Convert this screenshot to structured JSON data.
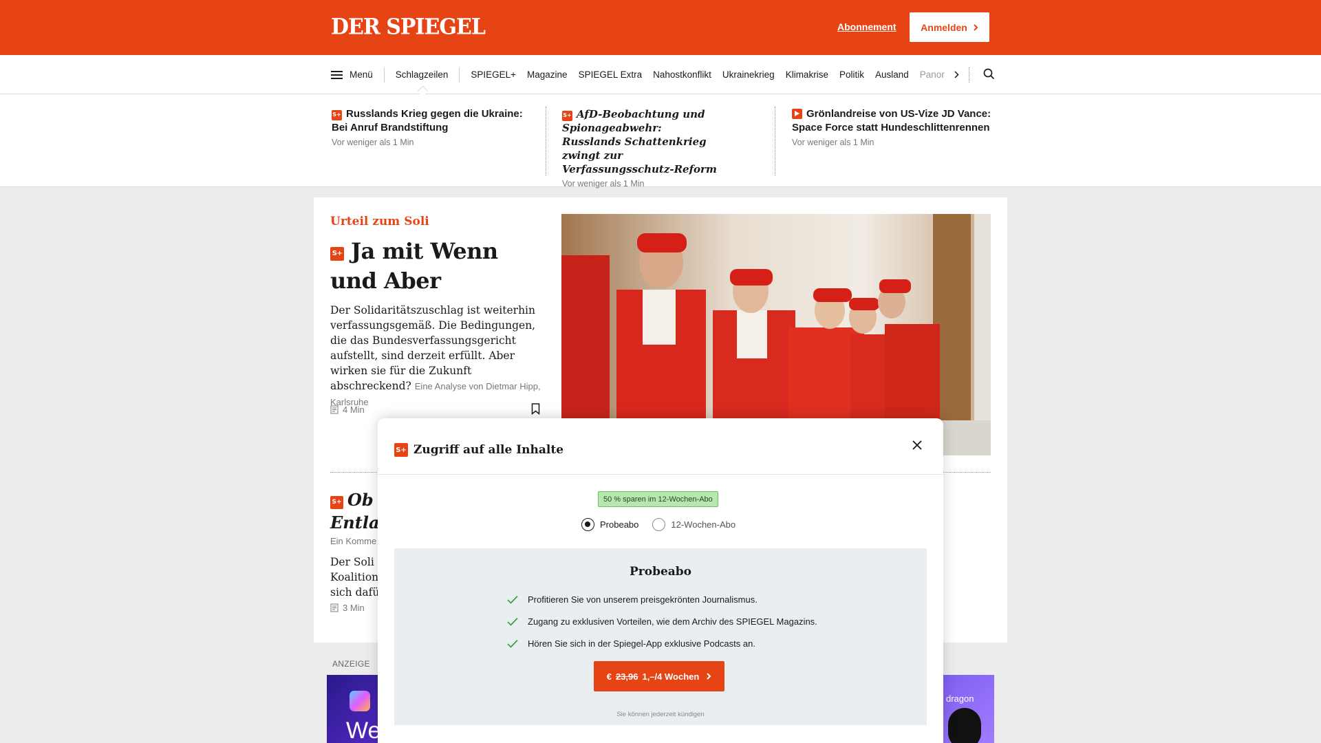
{
  "header": {
    "logo": "DER SPIEGEL",
    "abo_link": "Abonnement",
    "login_label": "Anmelden",
    "brand_color": "#e64415"
  },
  "nav": {
    "menu_label": "Menü",
    "active": "Schlagzeilen",
    "items": [
      "SPIEGEL+",
      "Magazine",
      "SPIEGEL Extra",
      "Nahostkonflikt",
      "Ukrainekrieg",
      "Klimakrise",
      "Politik",
      "Ausland"
    ],
    "truncated": "Panor",
    "icons": [
      "hamburger-icon",
      "chevron-right-icon",
      "search-icon"
    ]
  },
  "ticker": [
    {
      "badge": "S+",
      "title": "Russlands Krieg gegen die Ukraine: Bei Anruf Brandstiftung",
      "meta": "Vor weniger als 1 Min"
    },
    {
      "badge": "S+",
      "title": "AfD-Beobachtung und Spionageabwehr: Russlands Schattenkrieg zwingt zur Verfassungsschutz-Reform",
      "meta": "Vor weniger als 1 Min"
    },
    {
      "badge": "play",
      "title": "Grönlandreise von US-Vize JD Vance: Space Force statt Hundeschlittenrennen",
      "meta": "Vor weniger als 1 Min"
    }
  ],
  "lead": {
    "kicker": "Urteil zum Soli",
    "badge": "S+",
    "headline": "Ja mit Wenn und Aber",
    "teaser": "Der Solidaritätszuschlag ist weiterhin verfassungsgemäß. Die Bedingungen, die das Bundesverfassungsgericht aufstellt, sind derzeit erfüllt. Aber wirken sie für die Zukunft abschreckend?",
    "author": "Eine Analyse von Dietmar Hipp, Karlsruhe",
    "readtime": "4 Min"
  },
  "second": {
    "badge": "S+",
    "title_line1": "Ob",
    "title_line2": "Entlas",
    "meta": "Ein Komme",
    "teaser_lines": [
      "Der Soli is",
      "Koalition",
      "sich dafür"
    ],
    "readtime": "3 Min"
  },
  "ad": {
    "label": "ANZEIGE",
    "left_text": "We",
    "right_text": "dragon"
  },
  "modal": {
    "badge": "S+",
    "title": "Zugriff auf alle Inhalte",
    "save_badge": "50 % sparen im 12-Wochen-Abo",
    "options": [
      "Probeabo",
      "12-Wochen-Abo"
    ],
    "selected": "Probeabo",
    "offer_title": "Probeabo",
    "benefits": [
      "Profitieren Sie von unserem preisgekrönten Journalismus.",
      "Zugang zu exklusiven Vorteilen, wie dem Archiv des SPIEGEL Magazins.",
      "Hören Sie sich in der Spiegel-App exklusive Podcasts an."
    ],
    "cta_currency": "€",
    "cta_old_price": "23,96",
    "cta_new_price": "1,–/4 Wochen",
    "cancel_note": "Sie können jederzeit kündigen"
  }
}
